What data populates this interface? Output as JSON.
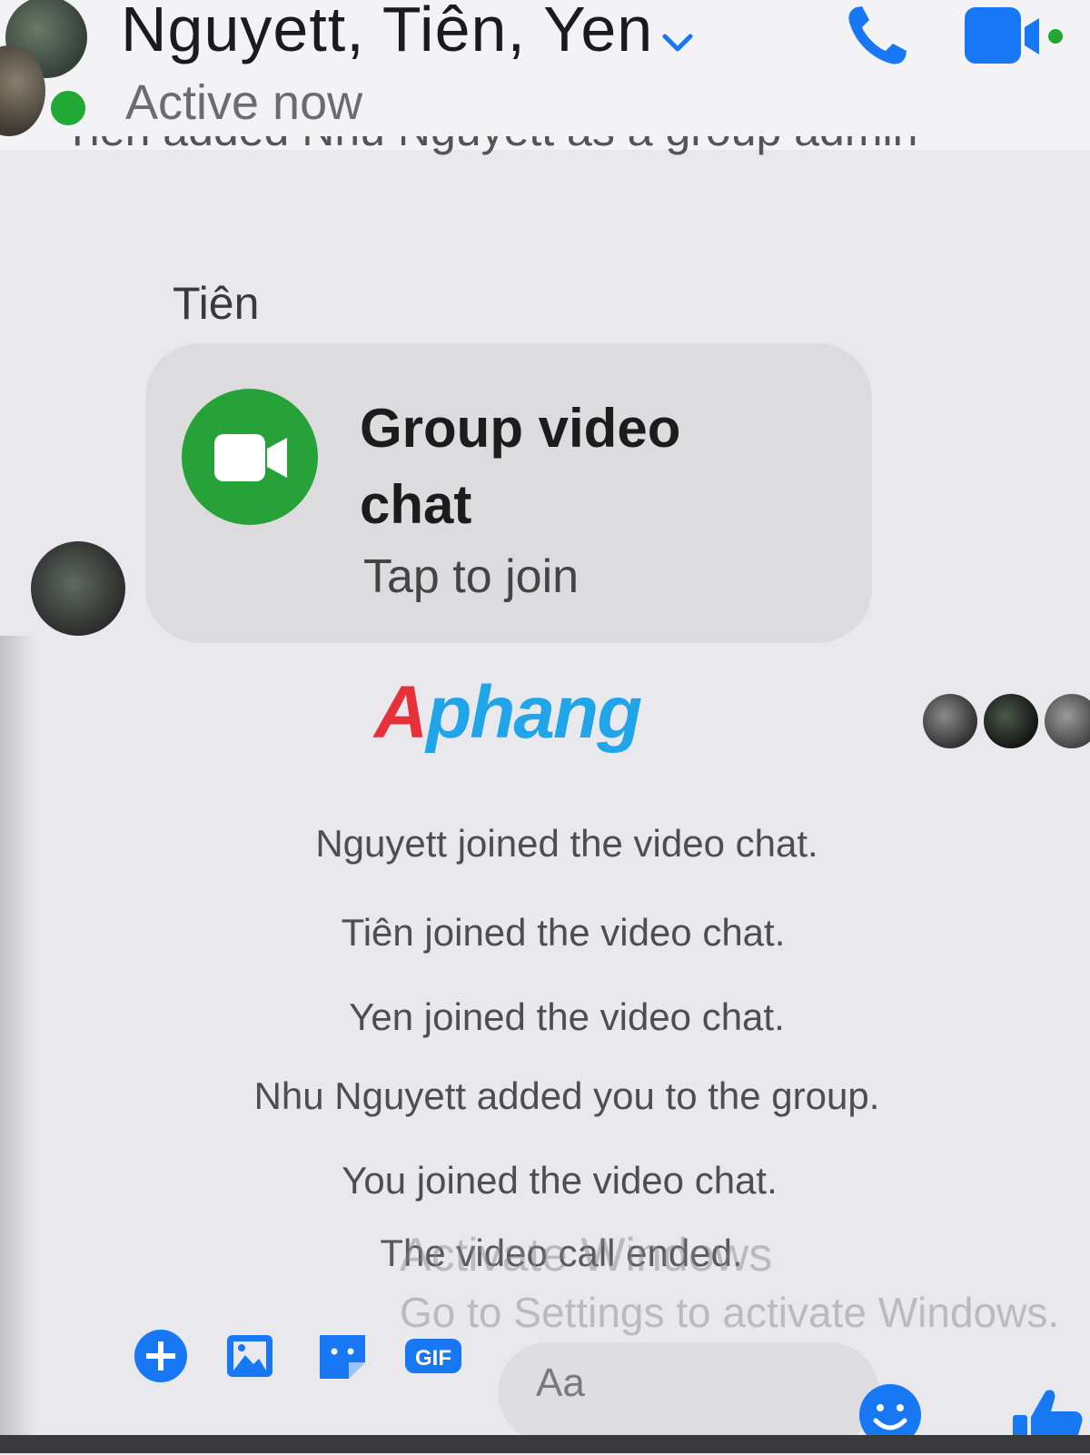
{
  "header": {
    "title": "Nguyett, Tiên, Yen",
    "status": "Active now",
    "partial_notice": "Tiên added Nhu Nguyett as a group admin"
  },
  "message": {
    "sender_name": "Tiên",
    "call_title": "Group video chat",
    "call_subtitle": "Tap to join"
  },
  "watermark": {
    "first": "A",
    "rest": "phang"
  },
  "events": [
    "Nguyett joined the video chat.",
    "Tiên joined the video chat.",
    "Yen joined the video chat.",
    "Nhu Nguyett added you to the group.",
    "You joined the video chat.",
    "The video call ended."
  ],
  "os_overlay": {
    "line1": "Activate Windows",
    "line2": "Go to Settings to activate Windows."
  },
  "composer": {
    "placeholder": "Aa",
    "gif_label": "GIF"
  },
  "colors": {
    "accent": "#1877f2",
    "online": "#21a935",
    "call_green": "#26a238"
  },
  "icons": [
    "chevron-down-icon",
    "phone-icon",
    "video-camera-icon",
    "plus-icon",
    "photo-icon",
    "sticker-icon",
    "gif-icon",
    "emoji-icon",
    "thumbs-up-icon"
  ]
}
